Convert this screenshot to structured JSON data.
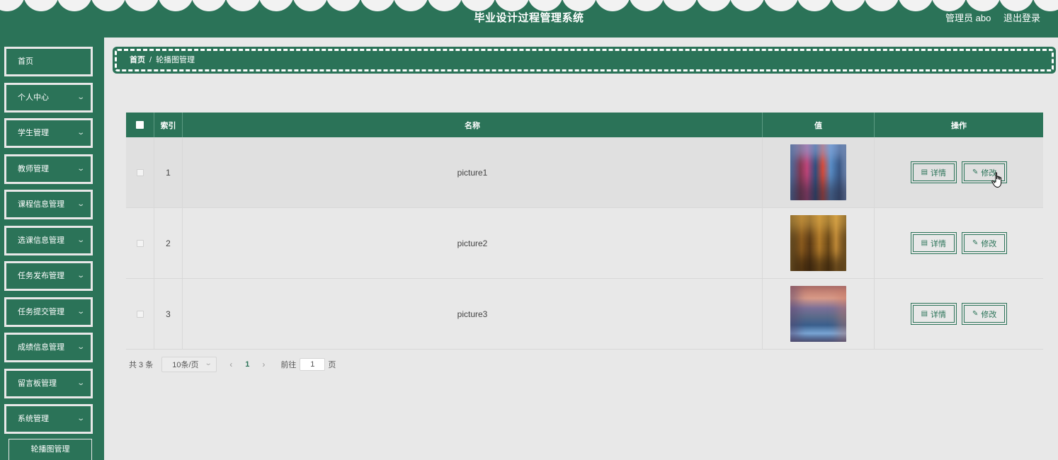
{
  "header": {
    "title": "毕业设计过程管理系统",
    "user_label": "管理员 abo",
    "logout_label": "退出登录"
  },
  "sidebar": {
    "items": [
      {
        "label": "首页",
        "has_children": false
      },
      {
        "label": "个人中心",
        "has_children": true
      },
      {
        "label": "学生管理",
        "has_children": true
      },
      {
        "label": "教师管理",
        "has_children": true
      },
      {
        "label": "课程信息管理",
        "has_children": true
      },
      {
        "label": "选课信息管理",
        "has_children": true
      },
      {
        "label": "任务发布管理",
        "has_children": true
      },
      {
        "label": "任务提交管理",
        "has_children": true
      },
      {
        "label": "成绩信息管理",
        "has_children": true
      },
      {
        "label": "留言板管理",
        "has_children": true
      },
      {
        "label": "系统管理",
        "has_children": true
      }
    ],
    "active_subitem": "轮播图管理"
  },
  "breadcrumb": {
    "home": "首页",
    "separator": "/",
    "current": "轮播图管理"
  },
  "table": {
    "columns": {
      "index": "索引",
      "name": "名称",
      "value": "值",
      "actions": "操作"
    },
    "rows": [
      {
        "index": "1",
        "name": "picture1",
        "thumb": "city-colorful-buildings"
      },
      {
        "index": "2",
        "name": "picture2",
        "thumb": "golden-ruins"
      },
      {
        "index": "3",
        "name": "picture3",
        "thumb": "city-waterfront-dusk"
      }
    ],
    "detail_label": "详情",
    "edit_label": "修改"
  },
  "pagination": {
    "total": "共 3 条",
    "page_size": "10条/页",
    "current_page": "1",
    "goto_label": "前往",
    "goto_value": "1",
    "page_unit": "页"
  },
  "colors": {
    "primary": "#2b7358",
    "background": "#e8e8e8"
  }
}
